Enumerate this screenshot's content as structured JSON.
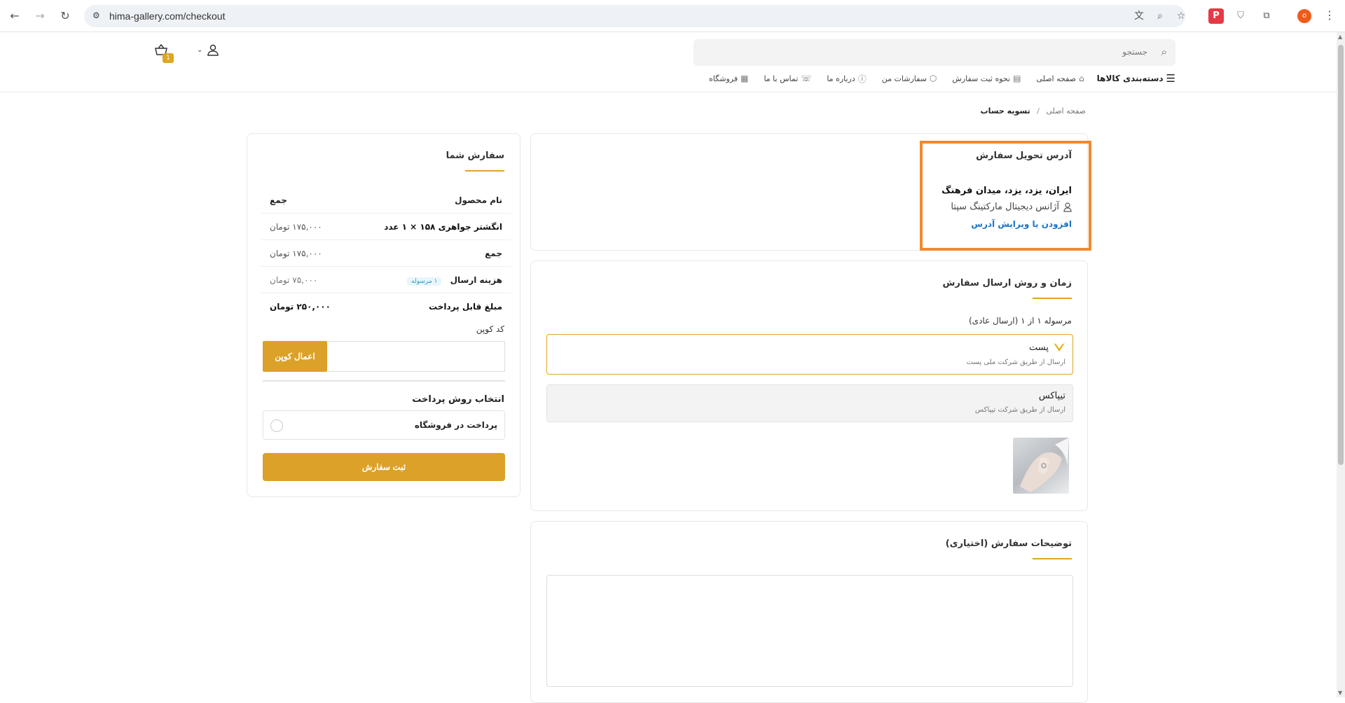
{
  "browser": {
    "url": "hima-gallery.com/checkout",
    "profile_initial": "o"
  },
  "header": {
    "search_placeholder": "جستجو",
    "cart_count": "1"
  },
  "nav": {
    "categories": "دسته‌بندی کالاها",
    "items": [
      {
        "label": "صفحه اصلی"
      },
      {
        "label": "نحوه ثبت سفارش"
      },
      {
        "label": "سفارشات من"
      },
      {
        "label": "درباره ما"
      },
      {
        "label": "تماس با ما"
      },
      {
        "label": "فروشگاه"
      }
    ]
  },
  "breadcrumb": {
    "home": "صفحه اصلی",
    "separator": "/",
    "current": "تسویه حساب"
  },
  "address": {
    "title": "آدرس تحویل سفارش",
    "line1": "ایران، یزد، یزد، میدان فرهنگ",
    "recipient": "آژانس دیجیتال مارکتینگ سپتا",
    "edit_link": "افزودن یا ویرایش آدرس"
  },
  "shipping": {
    "title": "زمان و روش ارسال سفارش",
    "parcel_label": "مرسوله ۱ از ۱ (ارسال عادی)",
    "options": [
      {
        "name": "پست",
        "desc": "ارسال از طریق شرکت ملی پست"
      },
      {
        "name": "تیپاکس",
        "desc": "ارسال از طریق شرکت تیپاکس"
      }
    ]
  },
  "notes": {
    "title": "توضیحات سفارش (اختیاری)"
  },
  "order": {
    "title": "سفارش شما",
    "head_product": "نام محصول",
    "head_total": "جمع",
    "item_name": "انگشتر جواهری ۱۵۸ × ۱ عدد",
    "item_price": "۱۷۵,۰۰۰ تومان",
    "subtotal_label": "جمع",
    "subtotal_value": "۱۷۵,۰۰۰ تومان",
    "shipping_label": "هزینه ارسال",
    "shipping_badge": "۱ مرسوله",
    "shipping_value": "۷۵,۰۰۰ تومان",
    "payable_label": "مبلغ قابل پرداخت",
    "payable_value": "۲۵۰,۰۰۰ تومان",
    "coupon_label": "کد کوپن",
    "coupon_button": "اعمال کوپن",
    "payment_title": "انتخاب روش پرداخت",
    "payment_option": "پرداخت در فروشگاه",
    "submit_button": "ثبت سفارش"
  },
  "colors": {
    "accent": "#dca128",
    "highlight": "#f08a2f",
    "link": "#1a73c8"
  }
}
